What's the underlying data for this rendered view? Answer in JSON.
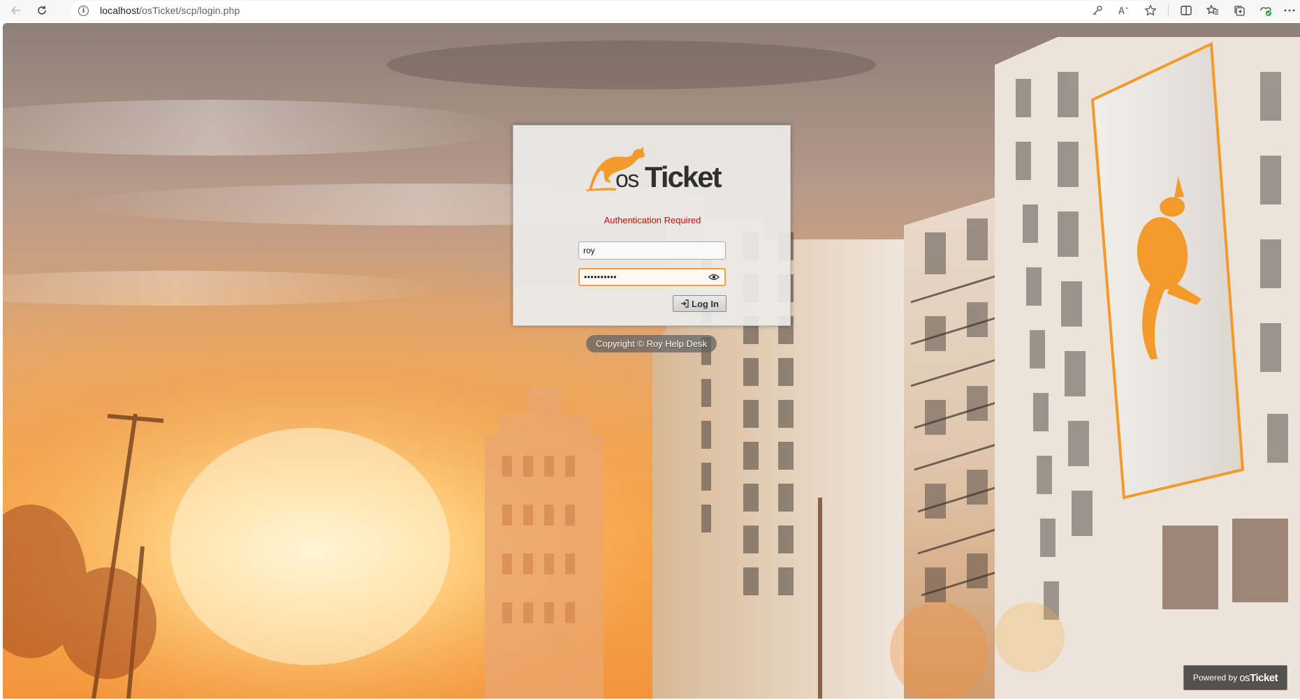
{
  "browser": {
    "url_host": "localhost",
    "url_path": "/osTicket/scp/login.php",
    "icons": [
      "back-arrow-icon",
      "refresh-icon",
      "info-icon",
      "key-icon",
      "read-aloud-icon",
      "favorite-star-icon",
      "split-screen-icon",
      "favorites-icon",
      "collections-icon",
      "extensions-icon",
      "more-icon"
    ]
  },
  "login": {
    "logo_text_os": "os",
    "logo_text_ticket": "Ticket",
    "auth_message": "Authentication Required",
    "username_value": "roy",
    "password_value": "••••••••••",
    "login_button_label": "Log In"
  },
  "footer": {
    "copyright": "Copyright © Roy Help Desk",
    "powered_prefix": "Powered by",
    "powered_os": "os",
    "powered_ticket": "Ticket"
  },
  "colors": {
    "accent_orange": "#f1a33b",
    "kangaroo": "#f39a2d",
    "error_red": "#d80000"
  }
}
